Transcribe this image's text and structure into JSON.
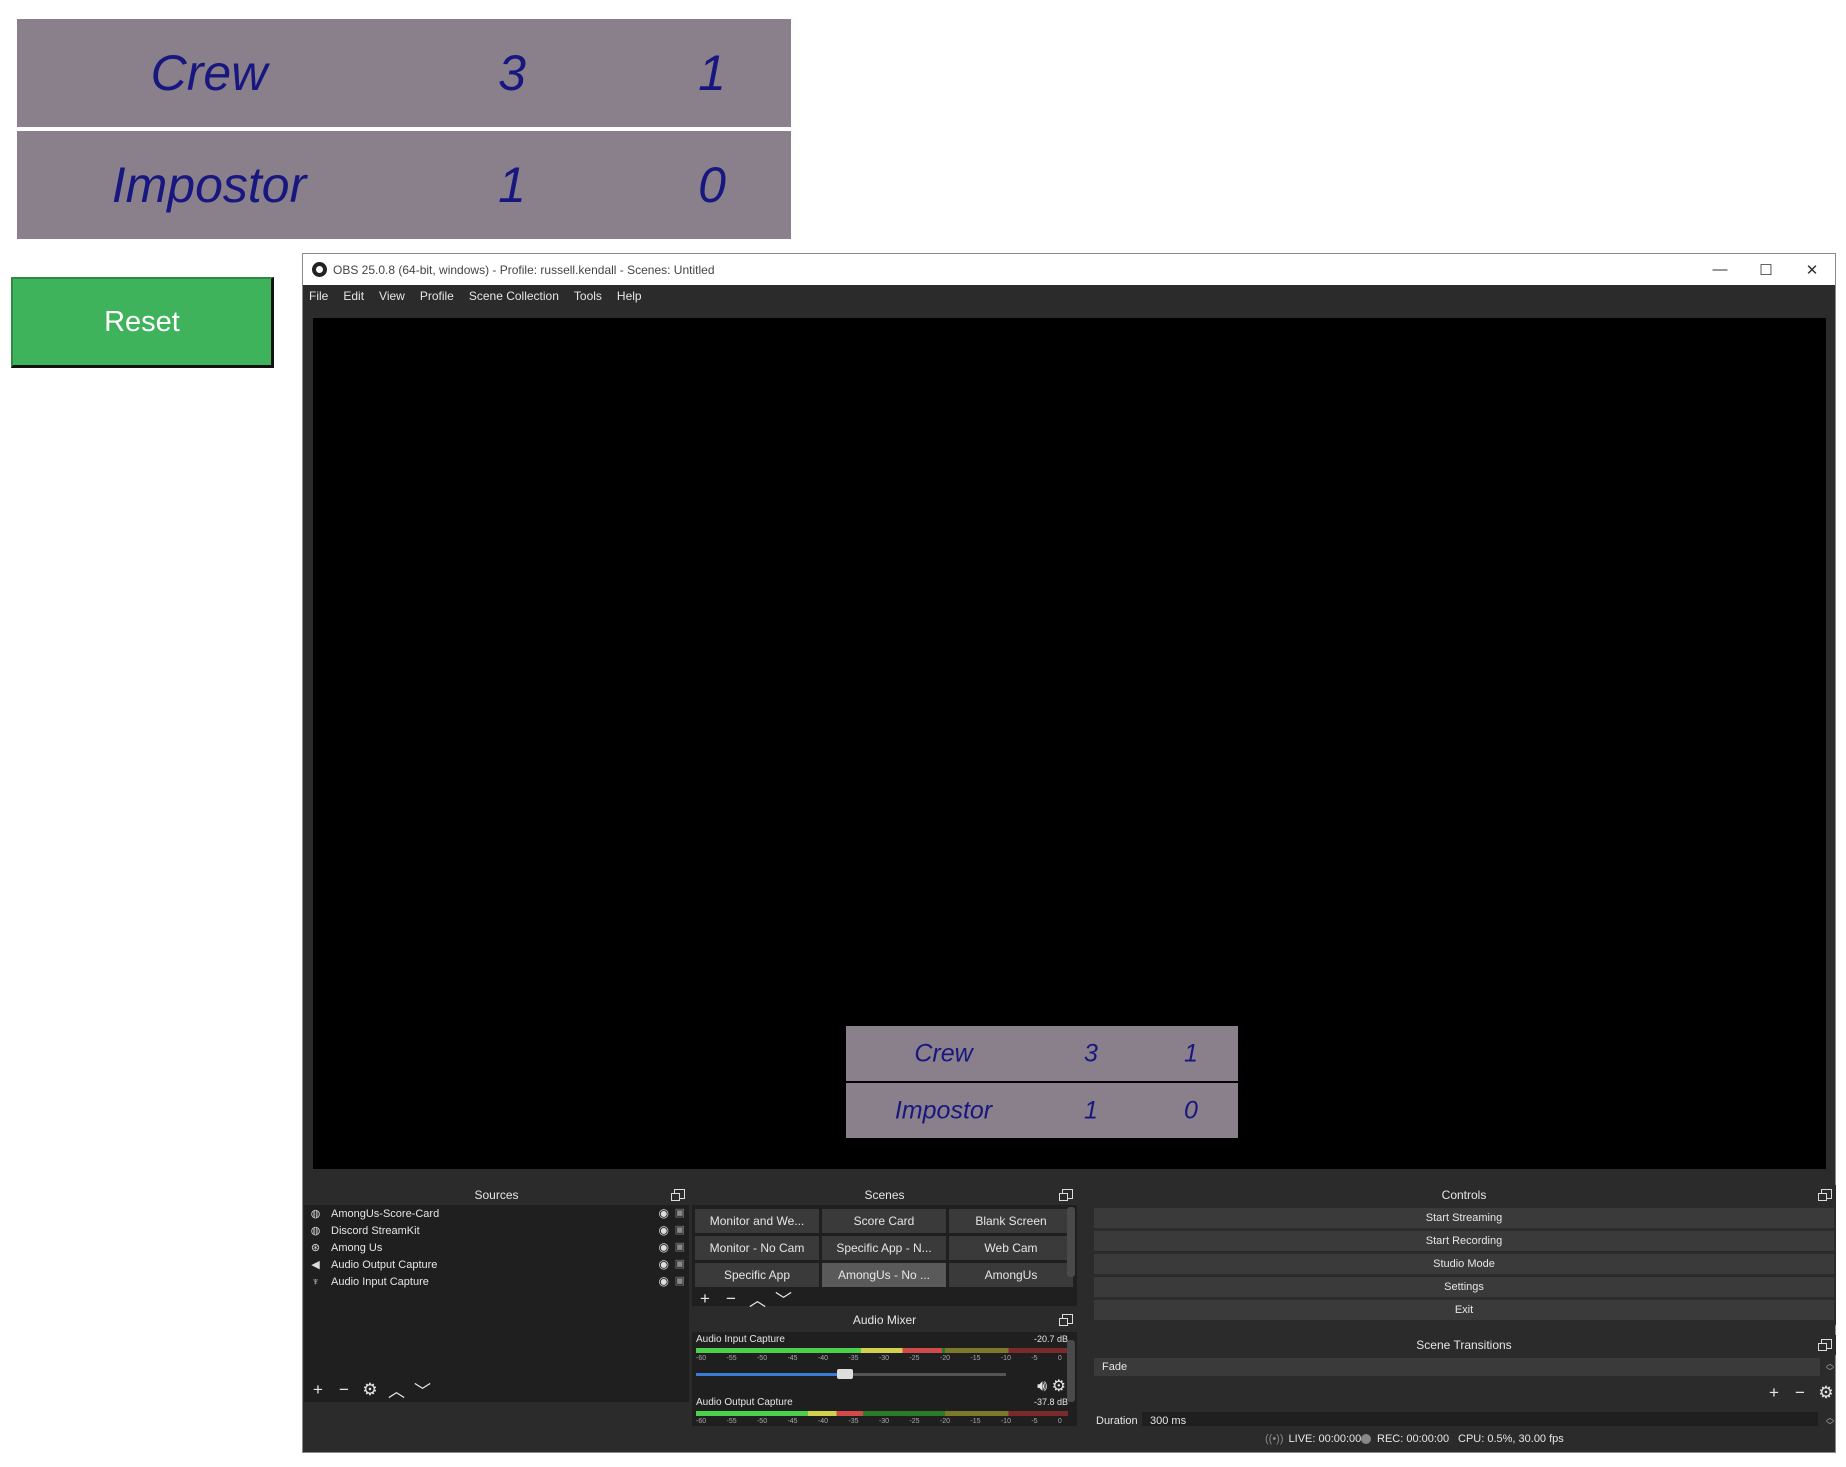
{
  "scorecard": {
    "rows": [
      {
        "name": "Crew",
        "v1": "3",
        "v2": "1"
      },
      {
        "name": "Impostor",
        "v1": "1",
        "v2": "0"
      }
    ]
  },
  "reset": {
    "label": "Reset"
  },
  "obs": {
    "title": "OBS 25.0.8 (64-bit, windows) - Profile: russell.kendall - Scenes: Untitled",
    "window_controls": [
      "—",
      "☐",
      "✕"
    ],
    "menu": [
      "File",
      "Edit",
      "View",
      "Profile",
      "Scene Collection",
      "Tools",
      "Help"
    ],
    "preview_card": [
      {
        "name": "Crew",
        "v1": "3",
        "v2": "1"
      },
      {
        "name": "Impostor",
        "v1": "1",
        "v2": "0"
      }
    ],
    "sources": {
      "title": "Sources",
      "items": [
        {
          "label": "AmongUs-Score-Card",
          "icon": "globe-icon"
        },
        {
          "label": "Discord StreamKit",
          "icon": "globe-icon"
        },
        {
          "label": "Among Us",
          "icon": "gamepad-icon"
        },
        {
          "label": "Audio Output Capture",
          "icon": "speaker-icon"
        },
        {
          "label": "Audio Input Capture",
          "icon": "microphone-icon"
        }
      ]
    },
    "scenes": {
      "title": "Scenes",
      "items": [
        "Monitor and We...",
        "Score Card",
        "Blank Screen",
        "Monitor - No Cam",
        "Specific App - N...",
        "Web Cam",
        "Specific App",
        "AmongUs - No ...",
        "AmongUs"
      ],
      "active_index": 7
    },
    "controls": {
      "title": "Controls",
      "buttons": [
        "Start Streaming",
        "Start Recording",
        "Studio Mode",
        "Settings",
        "Exit"
      ]
    },
    "mixer": {
      "title": "Audio Mixer",
      "channels": [
        {
          "name": "Audio Input Capture",
          "db": "-20.7 dB",
          "level": 0.66,
          "volume": 0.48
        },
        {
          "name": "Audio Output Capture",
          "db": "-37.8 dB",
          "level": 0.45,
          "volume": 0.48
        }
      ],
      "ticks": [
        "-60",
        "-55",
        "-50",
        "-45",
        "-40",
        "-35",
        "-30",
        "-25",
        "-20",
        "-15",
        "-10",
        "-5",
        "0"
      ]
    },
    "transitions": {
      "title": "Scene Transitions",
      "selected": "Fade",
      "duration_label": "Duration",
      "duration_value": "300 ms"
    },
    "status": {
      "live": "LIVE: 00:00:00",
      "rec": "REC: 00:00:00",
      "cpu": "CPU: 0.5%, 30.00 fps"
    }
  }
}
